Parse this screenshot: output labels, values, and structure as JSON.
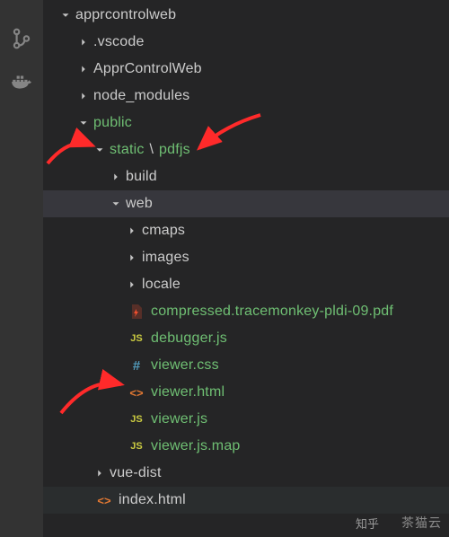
{
  "activitybar": {
    "icons": [
      "source-control-icon",
      "docker-icon"
    ]
  },
  "tree": {
    "root": "apprcontrolweb",
    "items": [
      {
        "name": ".vscode",
        "type": "folder",
        "state": "collapsed",
        "indent": 1
      },
      {
        "name": "ApprControlWeb",
        "type": "folder",
        "state": "collapsed",
        "indent": 1
      },
      {
        "name": "node_modules",
        "type": "folder",
        "state": "collapsed",
        "indent": 1
      },
      {
        "name": "public",
        "type": "folder",
        "state": "expanded",
        "indent": 1,
        "green": true
      },
      {
        "name_a": "static",
        "name_b": "pdfjs",
        "type": "folder-path",
        "state": "expanded",
        "indent": 2,
        "green": true
      },
      {
        "name": "build",
        "type": "folder",
        "state": "collapsed",
        "indent": 3
      },
      {
        "name": "web",
        "type": "folder",
        "state": "expanded",
        "indent": 3,
        "selected": true
      },
      {
        "name": "cmaps",
        "type": "folder",
        "state": "collapsed",
        "indent": 4
      },
      {
        "name": "images",
        "type": "folder",
        "state": "collapsed",
        "indent": 4
      },
      {
        "name": "locale",
        "type": "folder",
        "state": "collapsed",
        "indent": 4
      },
      {
        "name": "compressed.tracemonkey-pldi-09.pdf",
        "type": "file",
        "icon": "pdf",
        "indent": 4,
        "green": true
      },
      {
        "name": "debugger.js",
        "type": "file",
        "icon": "js",
        "indent": 4,
        "green": true
      },
      {
        "name": "viewer.css",
        "type": "file",
        "icon": "css",
        "indent": 4,
        "green": true
      },
      {
        "name": "viewer.html",
        "type": "file",
        "icon": "html",
        "indent": 4,
        "green": true
      },
      {
        "name": "viewer.js",
        "type": "file",
        "icon": "js",
        "indent": 4,
        "green": true
      },
      {
        "name": "viewer.js.map",
        "type": "file",
        "icon": "js",
        "indent": 4,
        "green": true
      },
      {
        "name": "vue-dist",
        "type": "folder",
        "state": "collapsed",
        "indent": 2
      },
      {
        "name": "index.html",
        "type": "file",
        "icon": "html",
        "indent": 2,
        "tail": true
      }
    ]
  },
  "path_separator": "\\",
  "watermark": "茶猫云",
  "zhihu": "知乎"
}
